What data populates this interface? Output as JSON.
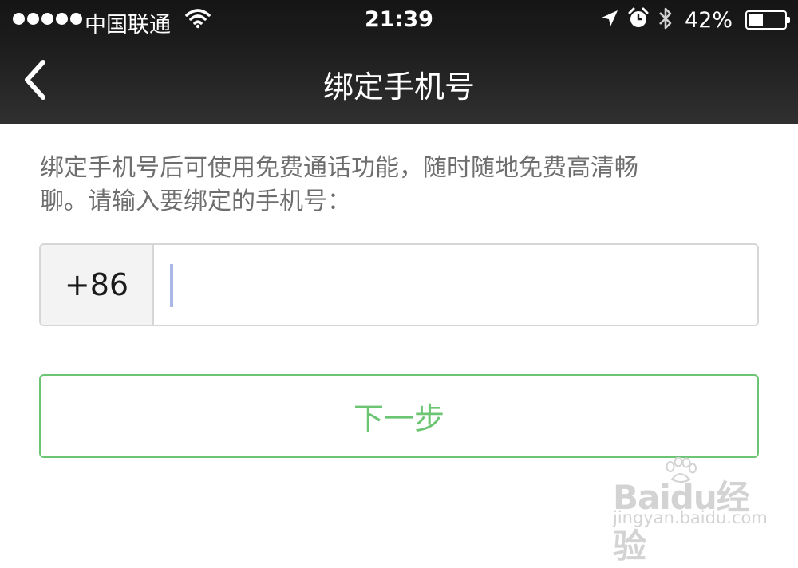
{
  "status_bar": {
    "carrier": "中国联通",
    "time": "21:39",
    "battery_percent": "42%",
    "battery_level": 0.42,
    "icons": [
      "signal-dots-icon",
      "wifi-icon",
      "location-arrow-icon",
      "alarm-icon",
      "bluetooth-icon",
      "battery-icon"
    ]
  },
  "navbar": {
    "title": "绑定手机号",
    "back_icon": "chevron-left-icon"
  },
  "content": {
    "description_line1": "绑定手机号后可使用免费通话功能，随时随地免费高清畅",
    "description_line2": "聊。请输入要绑定的手机号：",
    "country_code": "+86",
    "phone_value": "",
    "next_button": "下一步"
  },
  "watermark": {
    "logo": "Baidu经验",
    "url": "jingyan.baidu.com"
  },
  "colors": {
    "accent_green": "#6cc573",
    "nav_background": "#222222",
    "caret": "#a9b8e6"
  }
}
